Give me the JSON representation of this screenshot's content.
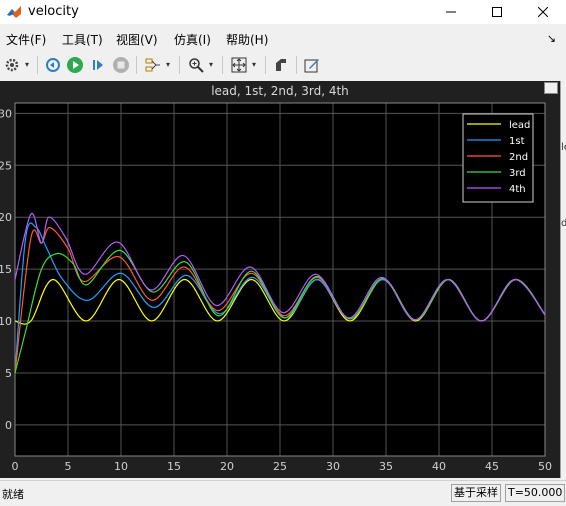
{
  "window": {
    "title": "velocity"
  },
  "menu": [
    "文件(F)",
    "工具(T)",
    "视图(V)",
    "仿真(I)",
    "帮助(H)"
  ],
  "toolbar": {
    "icons": [
      "settings-gear-icon",
      "step-back-icon",
      "run-icon",
      "step-forward-icon",
      "stop-icon",
      "signal-selector-icon",
      "zoom-icon",
      "fit-view-icon",
      "style-icon",
      "edit-icon"
    ]
  },
  "plot": {
    "title": "lead, 1st, 2nd, 3rd, 4th"
  },
  "right_strip": {
    "label_1": "le",
    "label_2": "d"
  },
  "status": {
    "ready": "就绪",
    "mode": "基于采样",
    "time": "T=50.000"
  },
  "chart_data": {
    "type": "line",
    "title": "lead, 1st, 2nd, 3rd, 4th",
    "xlim": [
      0,
      50
    ],
    "ylim": [
      -3,
      31
    ],
    "xticks": [
      0,
      5,
      10,
      15,
      20,
      25,
      30,
      35,
      40,
      45,
      50
    ],
    "yticks": [
      0,
      5,
      10,
      15,
      20,
      25,
      30
    ],
    "grid": true,
    "legend_position": "top-right",
    "background": "#000000",
    "series": [
      {
        "name": "lead",
        "color": "#ffff00",
        "x": [
          0,
          1.5,
          3.6,
          6.7,
          9.8,
          12.9,
          16.0,
          19.1,
          22.3,
          25.4,
          28.5,
          31.6,
          34.7,
          37.8,
          40.9,
          44.0,
          47.2,
          50
        ],
        "y": [
          10,
          10,
          14,
          10,
          14,
          10,
          14,
          10,
          14,
          10,
          14,
          10,
          14,
          10,
          14,
          10,
          14,
          10.6
        ]
      },
      {
        "name": "1st",
        "color": "#1ea0ff",
        "x": [
          0,
          1.0,
          2.0,
          3.0,
          4.5,
          6.9,
          10.0,
          13.1,
          16.2,
          19.3,
          22.4,
          25.5,
          28.5,
          31.6,
          34.7,
          37.8,
          40.9,
          44.0,
          47.2,
          50
        ],
        "y": [
          5,
          18,
          19,
          17,
          14,
          12,
          14.6,
          11.3,
          14.4,
          10.7,
          14.2,
          10.3,
          14.0,
          10.2,
          14.0,
          10.1,
          14.0,
          10.0,
          14.0,
          10.6
        ]
      },
      {
        "name": "2nd",
        "color": "#ff5a28",
        "x": [
          0,
          1.5,
          2.5,
          3.3,
          5.0,
          6.5,
          9.8,
          12.9,
          16.0,
          19.1,
          22.3,
          25.4,
          28.5,
          31.6,
          34.7,
          37.8,
          40.9,
          44.0,
          47.2,
          50
        ],
        "y": [
          5,
          18,
          17.5,
          19,
          17,
          13.8,
          16.2,
          12.0,
          15.2,
          11.0,
          14.6,
          10.5,
          14.2,
          10.2,
          14.1,
          10.1,
          14.0,
          10.0,
          14.0,
          10.6
        ]
      },
      {
        "name": "3rd",
        "color": "#3cdc3c",
        "x": [
          0,
          1.0,
          2.5,
          4.0,
          5.5,
          6.8,
          9.9,
          13.0,
          16.1,
          19.2,
          22.3,
          25.4,
          28.5,
          31.6,
          34.7,
          37.8,
          40.9,
          44.0,
          47.2,
          50
        ],
        "y": [
          5,
          9,
          15,
          16.5,
          15.5,
          13.5,
          16.8,
          12.8,
          15.7,
          10.5,
          14.8,
          10.3,
          14.3,
          10.2,
          14.1,
          10.1,
          14.0,
          10.0,
          14.0,
          10.6
        ]
      },
      {
        "name": "4th",
        "color": "#b45aff",
        "x": [
          0,
          1.5,
          2.5,
          3.2,
          4.8,
          6.6,
          9.7,
          12.8,
          15.9,
          19.0,
          22.2,
          25.3,
          28.4,
          31.5,
          34.6,
          37.7,
          40.8,
          44.0,
          47.1,
          50
        ],
        "y": [
          14,
          20.3,
          17.5,
          20,
          18,
          14.5,
          17.6,
          13.0,
          16.3,
          11.5,
          15.2,
          10.8,
          14.5,
          10.3,
          14.2,
          10.1,
          14.0,
          10.0,
          14.0,
          10.6
        ]
      }
    ]
  }
}
